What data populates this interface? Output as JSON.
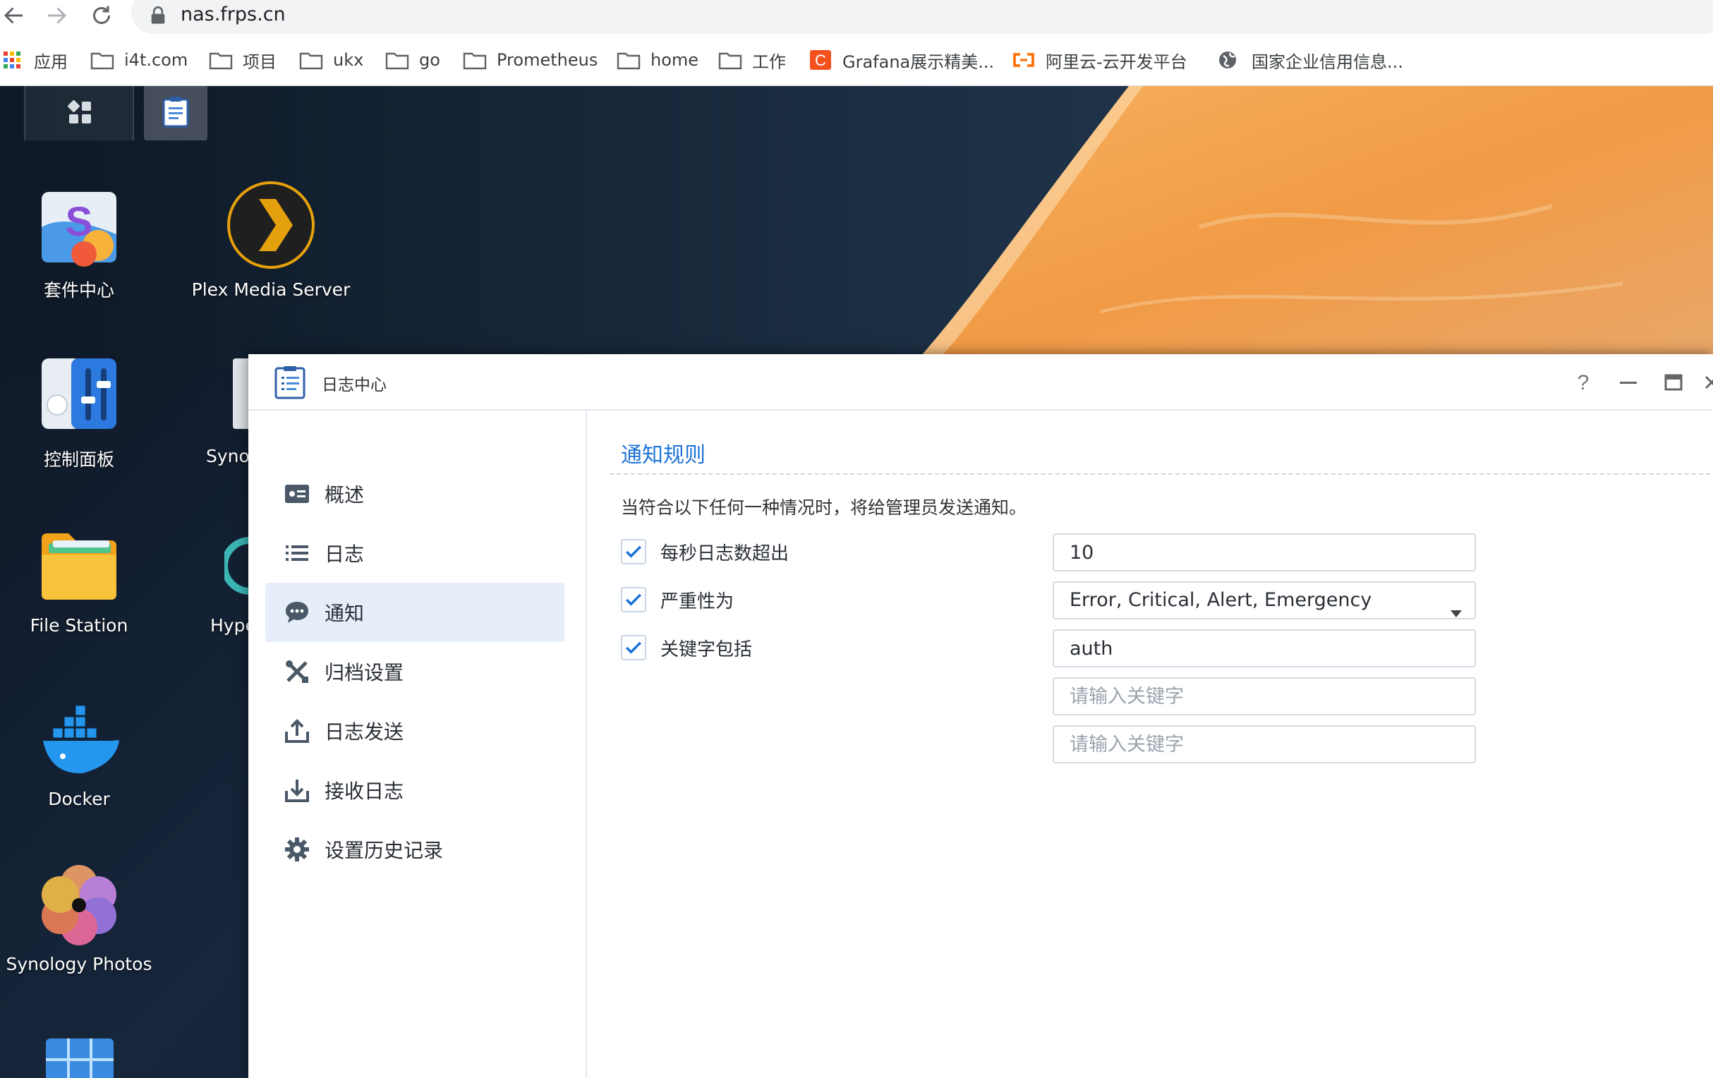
{
  "browser": {
    "url": "nas.frps.cn",
    "icons": [
      "back-arrow-icon",
      "forward-arrow-icon",
      "reload-icon",
      "lock-icon"
    ],
    "bookmarks": [
      {
        "label": "应用",
        "icon": "apps-grid-icon"
      },
      {
        "label": "i4t.com",
        "icon": "folder-icon"
      },
      {
        "label": "项目",
        "icon": "folder-icon"
      },
      {
        "label": "ukx",
        "icon": "folder-icon"
      },
      {
        "label": "go",
        "icon": "folder-icon"
      },
      {
        "label": "Prometheus",
        "icon": "folder-icon"
      },
      {
        "label": "home",
        "icon": "folder-icon"
      },
      {
        "label": "工作",
        "icon": "folder-icon"
      },
      {
        "label": "Grafana展示精美...",
        "icon": "csdn-logo-icon"
      },
      {
        "label": "阿里云-云开发平台",
        "icon": "aliyun-logo-icon"
      },
      {
        "label": "国家企业信用信息...",
        "icon": "globe-icon"
      }
    ]
  },
  "desktop": {
    "icons": [
      {
        "label": "套件中心",
        "icon": "package-center-icon"
      },
      {
        "label": "Plex Media Server",
        "icon": "plex-icon"
      },
      {
        "label": "控制面板",
        "icon": "control-panel-icon"
      },
      {
        "label": "Syno",
        "icon": "synology-app-icon"
      },
      {
        "label": "File Station",
        "icon": "file-station-icon"
      },
      {
        "label": "Hype",
        "icon": "hyper-backup-icon"
      },
      {
        "label": "Docker",
        "icon": "docker-icon"
      },
      {
        "label": "Synology Photos",
        "icon": "synology-photos-icon"
      }
    ]
  },
  "window": {
    "title": "日志中心",
    "sidebar": [
      {
        "label": "概述",
        "icon": "overview-card-icon"
      },
      {
        "label": "日志",
        "icon": "list-icon"
      },
      {
        "label": "通知",
        "icon": "chat-bubble-icon",
        "active": true
      },
      {
        "label": "归档设置",
        "icon": "tools-icon"
      },
      {
        "label": "日志发送",
        "icon": "upload-icon"
      },
      {
        "label": "接收日志",
        "icon": "download-icon"
      },
      {
        "label": "设置历史记录",
        "icon": "gear-icon"
      }
    ],
    "section_title": "通知规则",
    "description": "当符合以下任何一种情况时，将给管理员发送通知。",
    "rules": [
      {
        "label": "每秒日志数超出",
        "checked": true,
        "value": "10"
      },
      {
        "label": "严重性为",
        "checked": true,
        "value": "Error, Critical, Alert, Emergency"
      },
      {
        "label": "关键字包括",
        "checked": true,
        "value": "auth"
      }
    ],
    "extra_keyword_placeholder": "请输入关键字",
    "accent_color": "#1e74d6"
  }
}
